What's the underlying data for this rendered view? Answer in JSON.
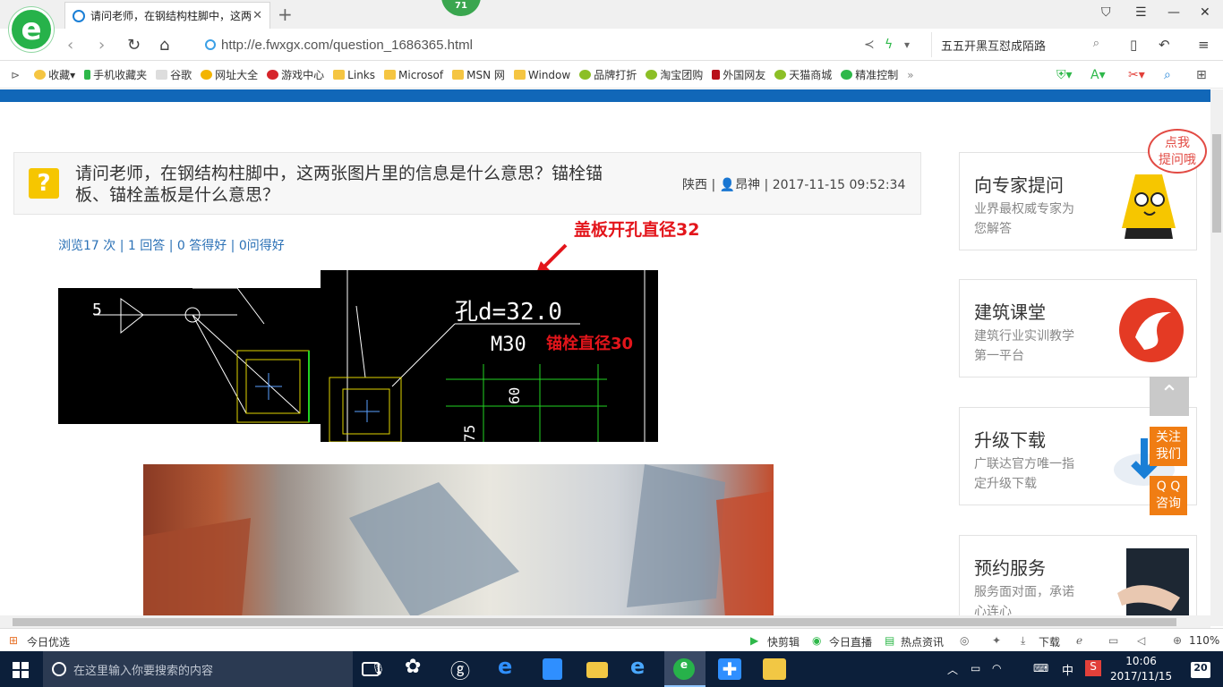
{
  "browser": {
    "tab_title": "请问老师，在钢结构柱脚中，这两张图片里的信息是什么意思？锚栓锚板、锚栓盖板是什么意思？",
    "tab_badge": "71",
    "url": "http://e.fwxgx.com/question_1686365.html",
    "search_text": "五五开黑互怼成陌路",
    "favorites": [
      "收藏",
      "手机收藏夹",
      "谷歌",
      "网址大全",
      "游戏中心",
      "Links",
      "Microsof",
      "MSN 网",
      "Window",
      "品牌打折",
      "淘宝团购",
      "外国网友",
      "天猫商城",
      "精准控制"
    ],
    "zoom": "110%"
  },
  "question": {
    "title": "请问老师，在钢结构柱脚中，这两张图片里的信息是什么意思？锚栓锚板、锚栓盖板是什么意思？",
    "location": "陕西",
    "author": "昂神",
    "datetime": "2017-11-15 09:52:34",
    "stats": "浏览17 次 | 1 回答 | 0 答得好 | 0问得好"
  },
  "images": {
    "annotation_top": "盖板开孔直径32",
    "annotation_mid": "锚栓直径30",
    "cad_hole": "孔d=32.0",
    "cad_bolt": "M30",
    "cad_dim_60": "60",
    "cad_dim_5": "5",
    "cad_dim_75": "75"
  },
  "sidebar": {
    "bubble": [
      "点我",
      "提问哦"
    ],
    "cards": [
      {
        "title": "向专家提问",
        "sub": "业界最权威专家为您解答"
      },
      {
        "title": "建筑课堂",
        "sub": "建筑行业实训教学第一平台"
      },
      {
        "title": "升级下载",
        "sub": "广联达官方唯一指定升级下载"
      },
      {
        "title": "预约服务",
        "sub": "服务面对面，承诺心连心"
      }
    ],
    "follow": [
      "关注",
      "我们"
    ],
    "qq": [
      "Q Q",
      "咨询"
    ]
  },
  "statusbar": {
    "left": "今日优选",
    "items": [
      "快剪辑",
      "今日直播",
      "热点资讯",
      "下载"
    ]
  },
  "taskbar": {
    "search_placeholder": "在这里输入你要搜索的内容",
    "ime": "中",
    "time": "10:06",
    "date": "2017/11/15",
    "notifications": "20"
  }
}
